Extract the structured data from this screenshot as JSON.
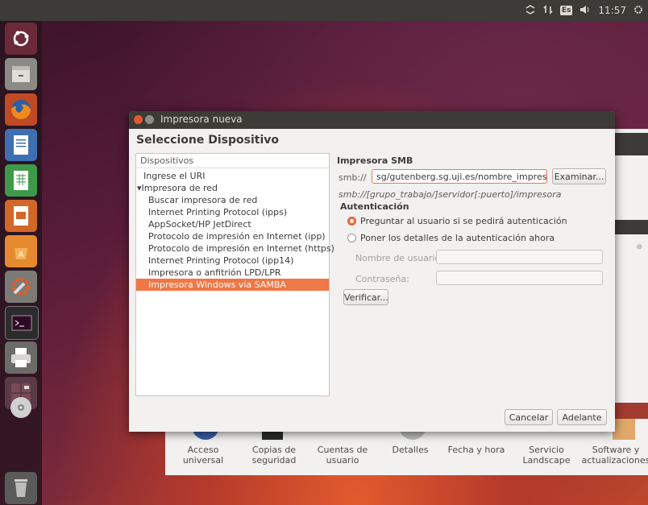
{
  "topbar": {
    "clock": "11:57",
    "keyboard": "Es"
  },
  "launcher": {
    "items": [
      "ubuntu-dash-icon",
      "files-icon",
      "firefox-icon",
      "writer-icon",
      "calc-icon",
      "impress-icon",
      "software-center-icon",
      "system-settings-icon",
      "terminal-icon",
      "printer-icon",
      "workspaces-icon",
      "dvd-icon",
      "trash-icon"
    ]
  },
  "settings_bg": {
    "items": [
      {
        "label": "Acceso\nuniversal"
      },
      {
        "label": "Copias de\nseguridad"
      },
      {
        "label": "Cuentas de\nusuario"
      },
      {
        "label": "Detalles"
      },
      {
        "label": "Fecha y hora"
      },
      {
        "label": "Servicio\nLandscape"
      },
      {
        "label": "Software y\nactualizaciones"
      }
    ]
  },
  "dialog": {
    "title": "Impresora nueva",
    "heading": "Seleccione Dispositivo",
    "devices_header": "Dispositivos",
    "devices": [
      {
        "label": "Ingrese el URI"
      },
      {
        "label": "▾Impresora de red"
      },
      {
        "label": "Buscar impresora de red"
      },
      {
        "label": "Internet Printing Protocol (ipps)"
      },
      {
        "label": "AppSocket/HP JetDirect"
      },
      {
        "label": "Protocolo de impresión en Internet (ipp)"
      },
      {
        "label": "Protocolo de impresión en Internet (https)"
      },
      {
        "label": "Internet Printing Protocol (ipp14)"
      },
      {
        "label": "Impresora o anfitrión LPD/LPR"
      },
      {
        "label": "Impresora Windows vía SAMBA"
      }
    ],
    "smb": {
      "section_title": "Impresora SMB",
      "prefix": "smb://",
      "uri_value": "sg/gutenberg.sg.uji.es/nombre_impresora",
      "browse_button": "Examinar...",
      "hint": "smb://[grupo_trabajo/]servidor[:puerto]/impresora"
    },
    "auth": {
      "title": "Autenticación",
      "option_ask": "Preguntar al usuario si se pedirá autenticación",
      "option_set": "Poner los detalles de la autenticación ahora",
      "username_label": "Nombre de usuario:",
      "password_label": "Contraseña:",
      "verify_button": "Verificar..."
    },
    "cancel_button": "Cancelar",
    "forward_button": "Adelante"
  }
}
